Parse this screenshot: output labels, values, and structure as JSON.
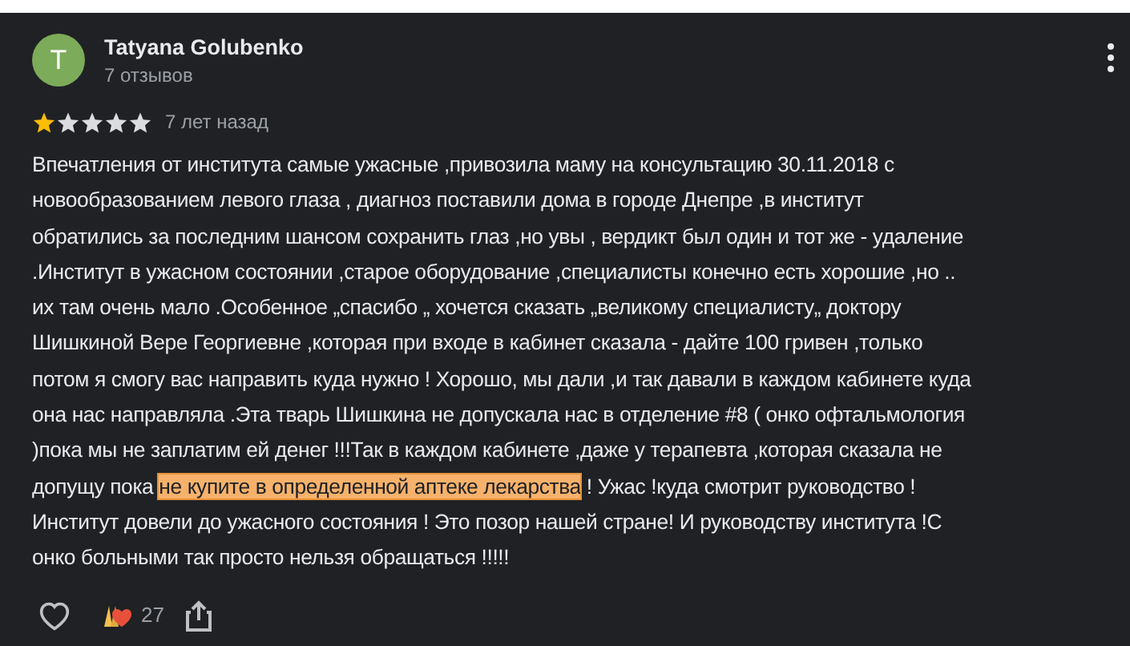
{
  "review": {
    "author": {
      "initial": "T",
      "name": "Tatyana Golubenko",
      "meta": "7 отзывов"
    },
    "stars": 1,
    "time": "7 лет назад",
    "text": [
      {
        "text": "Впечатления от института самые ужасные ,привозила маму на консультацию 30.11.2018 с\nновообразованием левого глаза , диагноз поставили дома в городе Днепре ,в институт\nобратились за последним шансом сохранить глаз ,но увы , вердикт был один и тот же - удаление\n.Институт в ужасном состоянии ,старое оборудование ,специалисты конечно есть хорошие ,но ..\nих там очень мало .Особенное „спасибо „ хочется сказать „великому специалисту„ доктору\nШишкиной Вере Георгиевне ,которая при входе в кабинет сказала - дайте 100 гривен ,только\nпотом я смогу вас направить куда нужно ! Хорошо, мы дали ,и так давали в каждом кабинете куда\nона нас направляла .Эта тварь Шишкина не допускала нас в отделение #8 ( онко офтальмология\n)пока мы не заплатим ей денег !!!Так в каждом кабинете ,даже у терапевта ,которая сказала не\nдопущу пока ",
        "highlighted": false
      },
      {
        "text": "не купите в определенной аптеке лекарства",
        "highlighted": true
      },
      {
        "text": " ! Ужас !куда смотрит руководство !\nИнститут довели до ужасного состояния ! Это позор нашей стране! И руководству института !С\nонко больными так просто нельзя обращаться !!!!!",
        "highlighted": false
      }
    ],
    "reactions": {
      "count": "27"
    }
  }
}
